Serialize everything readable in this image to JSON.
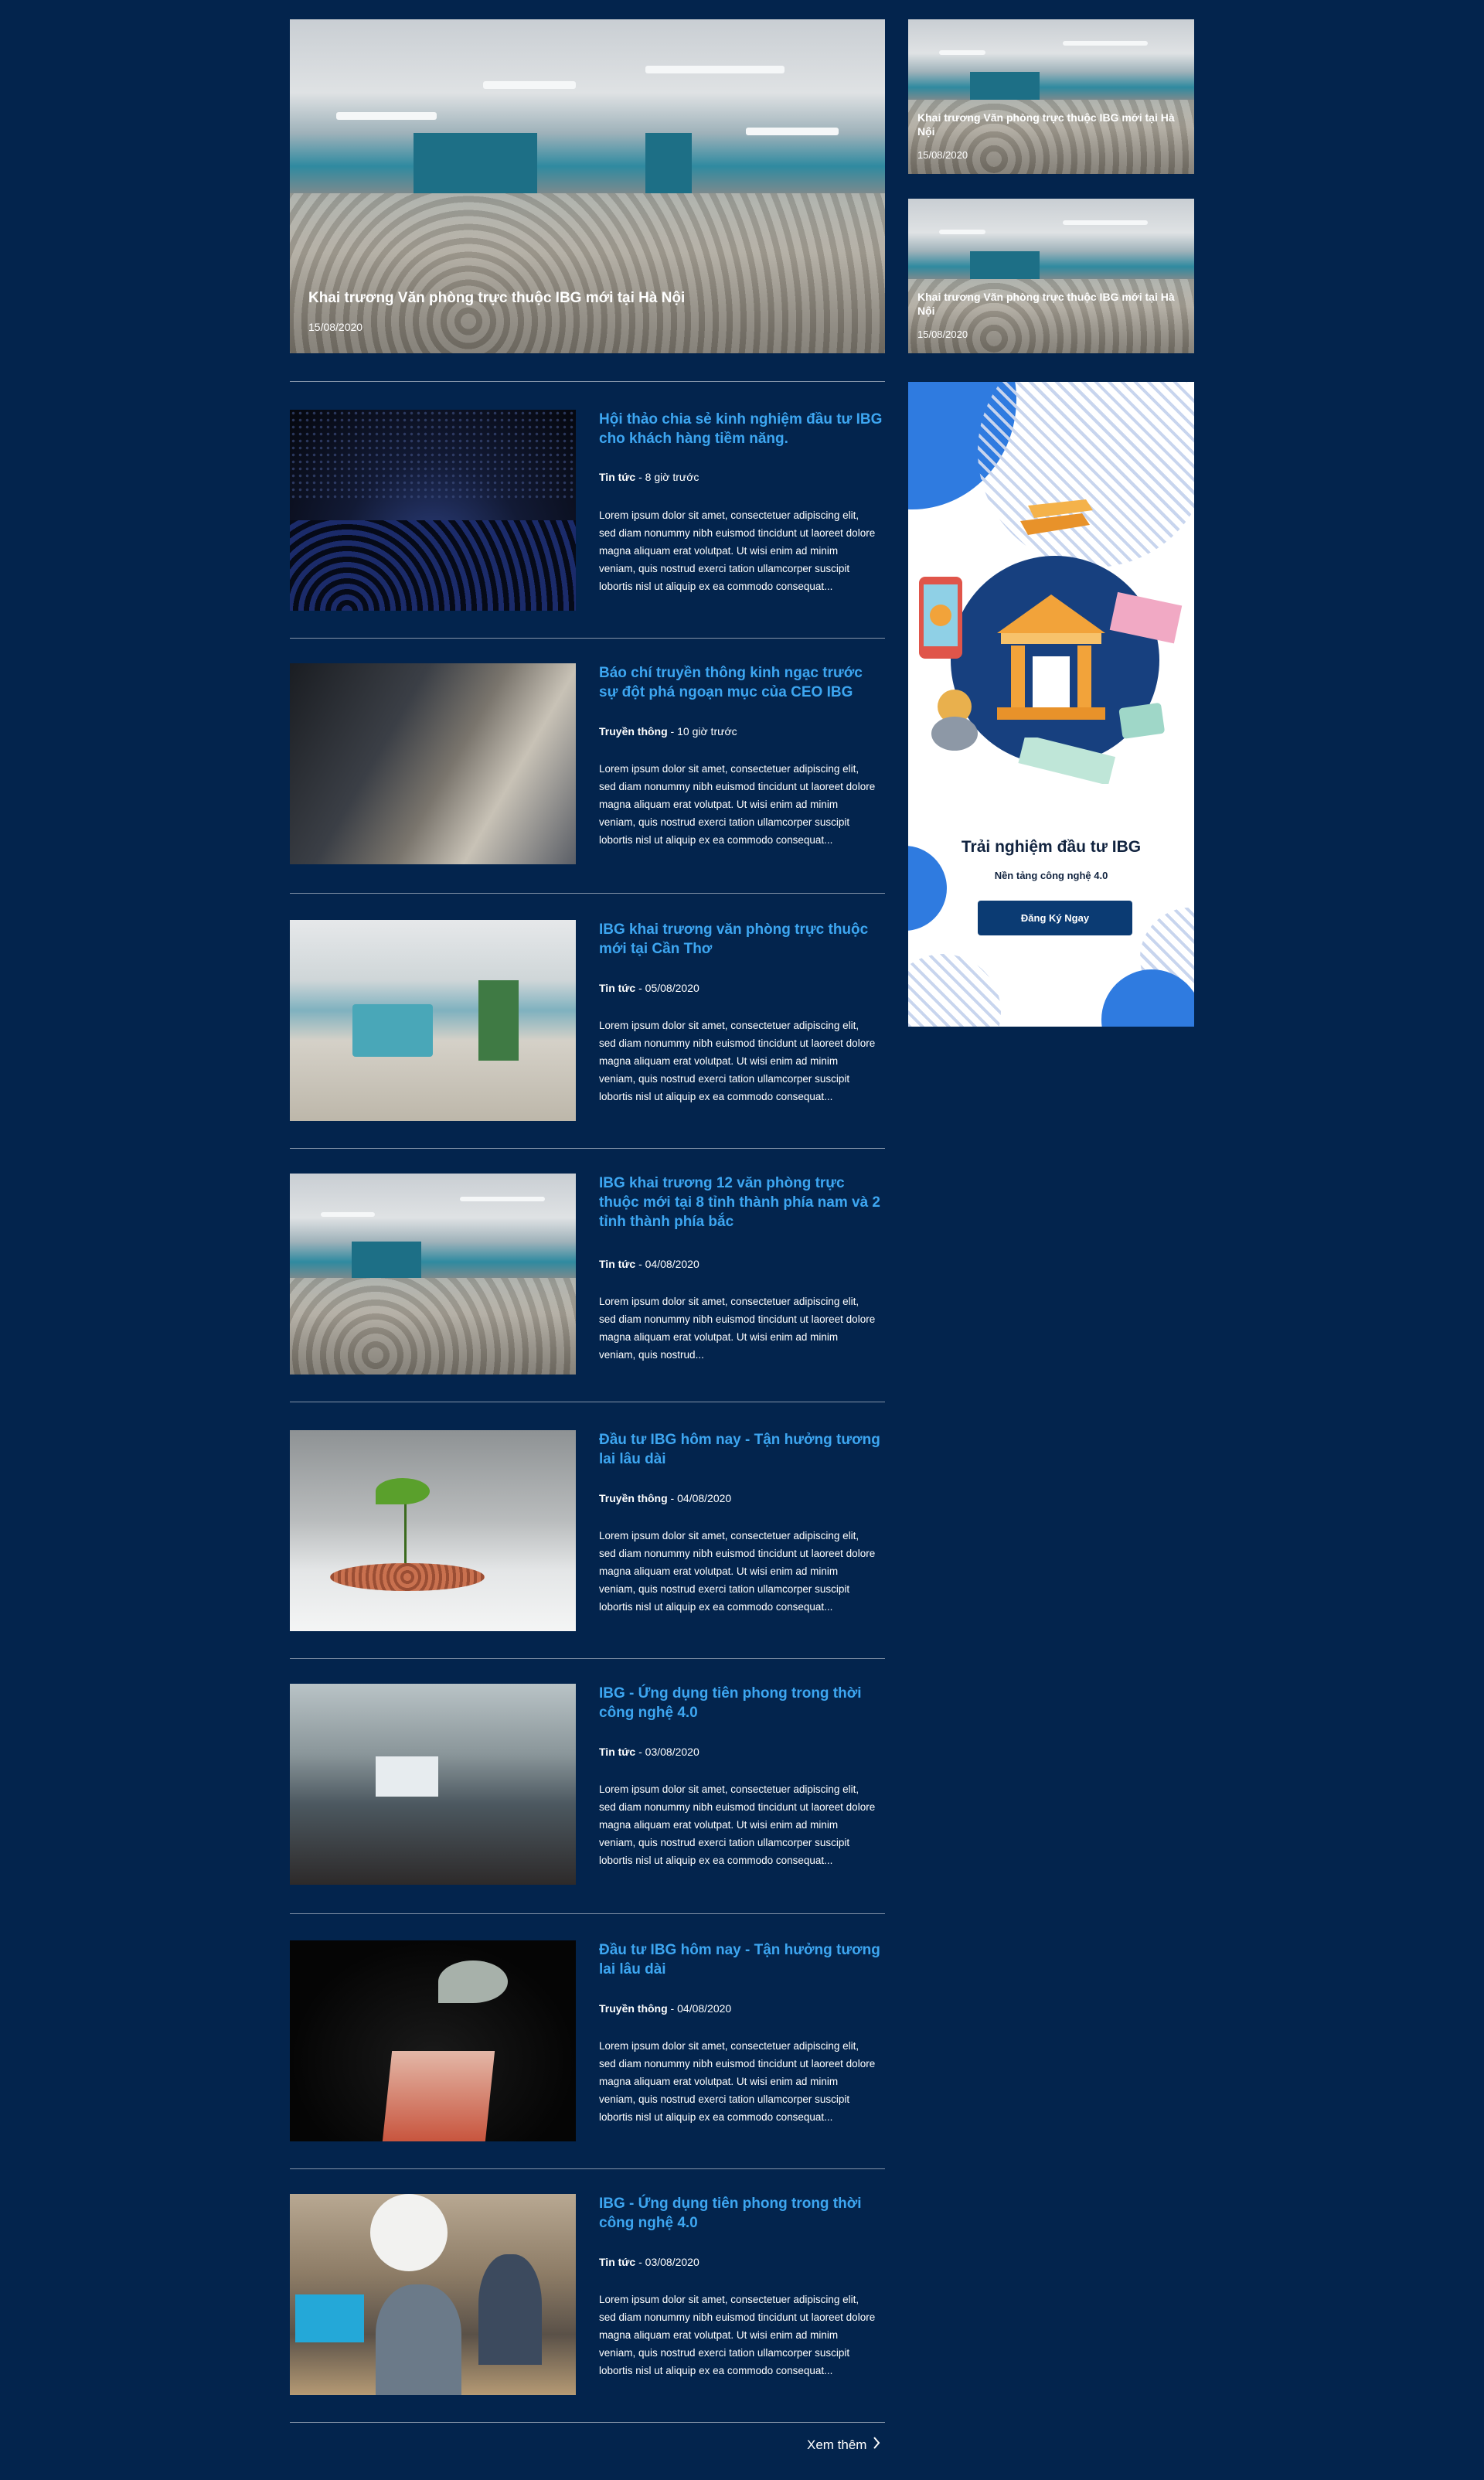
{
  "hero": {
    "main": {
      "title": "Khai trương Văn phòng trực thuộc IBG mới tại Hà Nội",
      "date": "15/08/2020"
    },
    "side": [
      {
        "title": "Khai trương Văn phòng trực thuộc IBG mới tại Hà Nội",
        "date": "15/08/2020"
      },
      {
        "title": "Khai trương Văn phòng trực thuộc IBG mới tại Hà Nội",
        "date": "15/08/2020"
      }
    ]
  },
  "articles": [
    {
      "title": "Hội thảo chia sẻ kinh nghiệm đầu tư IBG cho khách hàng tiềm năng.",
      "category": "Tin tức",
      "time": "8 giờ trước",
      "excerpt": "Lorem ipsum dolor sit amet, consectetuer adipiscing elit, sed diam nonummy nibh euismod tincidunt ut laoreet dolore magna aliquam erat volutpat. Ut wisi enim ad minim veniam, quis nostrud exerci tation ullamcorper suscipit lobortis nisl ut aliquip ex ea commodo consequat..."
    },
    {
      "title": "Báo chí truyền thông kinh ngạc trước sự đột phá ngoạn mục của CEO IBG",
      "category": "Truyền thông",
      "time": "10 giờ trước",
      "excerpt": "Lorem ipsum dolor sit amet, consectetuer adipiscing elit, sed diam nonummy nibh euismod tincidunt ut laoreet dolore magna aliquam erat volutpat. Ut wisi enim ad minim veniam, quis nostrud exerci tation ullamcorper suscipit lobortis nisl ut aliquip ex ea commodo consequat..."
    },
    {
      "title": "IBG khai trương văn phòng trực thuộc mới tại Cần Thơ",
      "category": "Tin tức",
      "time": "05/08/2020",
      "excerpt": "Lorem ipsum dolor sit amet, consectetuer adipiscing elit, sed diam nonummy nibh euismod tincidunt ut laoreet dolore magna aliquam erat volutpat. Ut wisi enim ad minim veniam, quis nostrud exerci tation ullamcorper suscipit lobortis nisl ut aliquip ex ea commodo consequat..."
    },
    {
      "title": "IBG khai trương 12 văn phòng trực thuộc mới tại 8 tỉnh thành phía nam và 2 tỉnh thành phía bắc",
      "category": "Tin tức",
      "time": "04/08/2020",
      "excerpt": "Lorem ipsum dolor sit amet, consectetuer adipiscing elit, sed diam nonummy nibh euismod tincidunt ut laoreet dolore magna aliquam erat volutpat. Ut wisi enim ad minim veniam, quis nostrud..."
    },
    {
      "title": "Đầu tư IBG hôm nay - Tận hưởng tương lai lâu dài",
      "category": "Truyền thông",
      "time": "04/08/2020",
      "excerpt": "Lorem ipsum dolor sit amet, consectetuer adipiscing elit, sed diam nonummy nibh euismod tincidunt ut laoreet dolore magna aliquam erat volutpat. Ut wisi enim ad minim veniam, quis nostrud exerci tation ullamcorper suscipit lobortis nisl ut aliquip ex ea commodo consequat..."
    },
    {
      "title": "IBG - Ứng dụng tiên phong trong thời công nghệ 4.0",
      "category": "Tin tức",
      "time": "03/08/2020",
      "excerpt": "Lorem ipsum dolor sit amet, consectetuer adipiscing elit, sed diam nonummy nibh euismod tincidunt ut laoreet dolore magna aliquam erat volutpat. Ut wisi enim ad minim veniam, quis nostrud exerci tation ullamcorper suscipit lobortis nisl ut aliquip ex ea commodo consequat..."
    },
    {
      "title": "Đầu tư IBG hôm nay - Tận hưởng tương lai lâu dài",
      "category": "Truyền thông",
      "time": "04/08/2020",
      "excerpt": "Lorem ipsum dolor sit amet, consectetuer adipiscing elit, sed diam nonummy nibh euismod tincidunt ut laoreet dolore magna aliquam erat volutpat. Ut wisi enim ad minim veniam, quis nostrud exerci tation ullamcorper suscipit lobortis nisl ut aliquip ex ea commodo consequat..."
    },
    {
      "title": "IBG - Ứng dụng tiên phong trong thời công nghệ 4.0",
      "category": "Tin tức",
      "time": "03/08/2020",
      "excerpt": "Lorem ipsum dolor sit amet, consectetuer adipiscing elit, sed diam nonummy nibh euismod tincidunt ut laoreet dolore magna aliquam erat volutpat. Ut wisi enim ad minim veniam, quis nostrud exerci tation ullamcorper suscipit lobortis nisl ut aliquip ex ea commodo consequat..."
    }
  ],
  "banner": {
    "title": "Trải nghiệm đầu tư IBG",
    "subtitle": "Nền tảng công nghệ 4.0",
    "cta": "Đăng Ký Ngay"
  },
  "more_label": "Xem thêm"
}
